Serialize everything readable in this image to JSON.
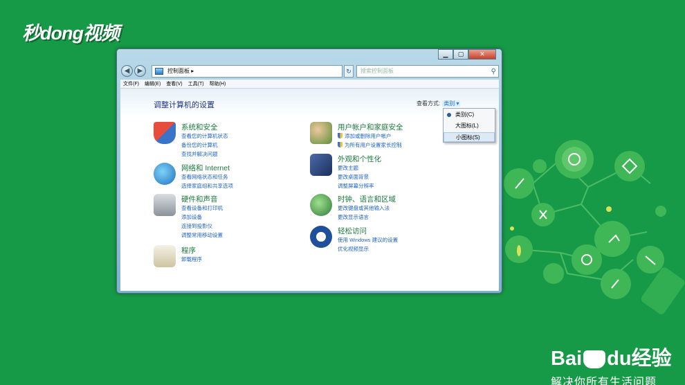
{
  "brand_top": "秒dong视频",
  "brand_bottom": {
    "name_left": "Bai",
    "name_mid": "du",
    "name_right": "经验",
    "slogan": "解决你所有生活问题"
  },
  "window": {
    "address": "控制面板",
    "search_placeholder": "搜索控制面板",
    "menu": [
      "文件(F)",
      "编辑(E)",
      "查看(V)",
      "工具(T)",
      "帮助(H)"
    ],
    "page_title": "调整计算机的设置",
    "view_by_label": "查看方式:",
    "view_by_value": "类别",
    "view_menu": [
      "类别(C)",
      "大图标(L)",
      "小图标(S)"
    ]
  },
  "categories_left": [
    {
      "title": "系统和安全",
      "links": [
        "查看您的计算机状态",
        "备份您的计算机",
        "查找并解决问题"
      ]
    },
    {
      "title": "网络和 Internet",
      "links": [
        "查看网络状态和任务",
        "选择家庭组和共享选项"
      ]
    },
    {
      "title": "硬件和声音",
      "links": [
        "查看设备和打印机",
        "添加设备",
        "连接到投影仪",
        "调整常用移动设置"
      ]
    },
    {
      "title": "程序",
      "links": [
        "卸载程序"
      ]
    }
  ],
  "categories_right": [
    {
      "title": "用户帐户和家庭安全",
      "links": [
        "添加或删除用户帐户",
        "为所有用户设置家长控制"
      ]
    },
    {
      "title": "外观和个性化",
      "links": [
        "更改主题",
        "更改桌面背景",
        "调整屏幕分辨率"
      ]
    },
    {
      "title": "时钟、语言和区域",
      "links": [
        "更改键盘或其他输入法",
        "更改显示语言"
      ]
    },
    {
      "title": "轻松访问",
      "links": [
        "使用 Windows 建议的设置",
        "优化视频显示"
      ]
    }
  ]
}
